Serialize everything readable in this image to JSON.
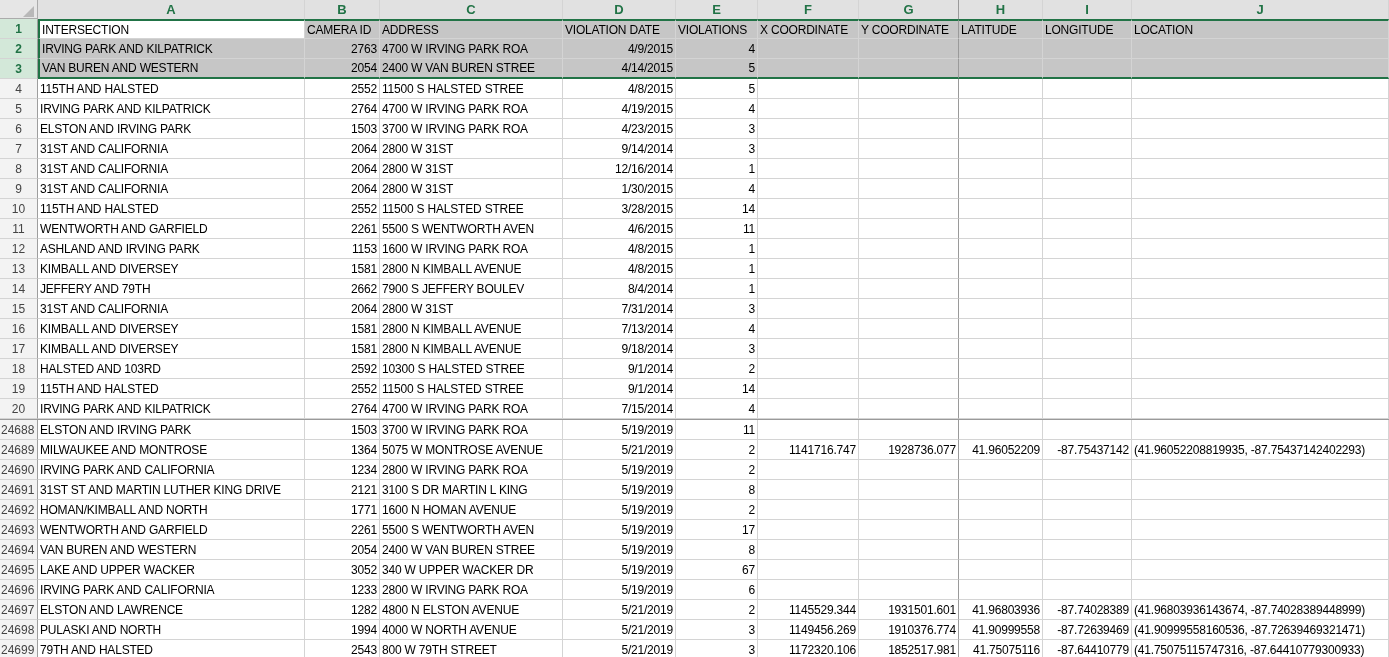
{
  "columns": [
    {
      "letter": "A",
      "kind": "text",
      "selected": true,
      "split": false
    },
    {
      "letter": "B",
      "kind": "number",
      "selected": true,
      "split": false
    },
    {
      "letter": "C",
      "kind": "text",
      "selected": true,
      "split": false
    },
    {
      "letter": "D",
      "kind": "number",
      "selected": true,
      "split": false
    },
    {
      "letter": "E",
      "kind": "number",
      "selected": true,
      "split": false
    },
    {
      "letter": "F",
      "kind": "number",
      "selected": true,
      "split": false
    },
    {
      "letter": "G",
      "kind": "number",
      "selected": true,
      "split": true
    },
    {
      "letter": "H",
      "kind": "number",
      "selected": true,
      "split": false
    },
    {
      "letter": "I",
      "kind": "number",
      "selected": true,
      "split": false
    },
    {
      "letter": "J",
      "kind": "text",
      "selected": true,
      "split": false
    }
  ],
  "frozen_rows": [
    {
      "number": "1",
      "kind": "header",
      "selected": true,
      "active": true,
      "cells": [
        "INTERSECTION",
        "CAMERA ID",
        "ADDRESS",
        "VIOLATION DATE",
        "VIOLATIONS",
        "X COORDINATE",
        "Y COORDINATE",
        "LATITUDE",
        "LONGITUDE",
        "LOCATION"
      ]
    },
    {
      "number": "2",
      "kind": "data",
      "selected": true,
      "active": false,
      "cells": [
        "IRVING PARK AND KILPATRICK",
        "2763",
        "4700 W IRVING PARK ROA",
        "4/9/2015",
        "4",
        null,
        null,
        null,
        null,
        null
      ]
    },
    {
      "number": "3",
      "kind": "data",
      "selected": true,
      "active": false,
      "cells": [
        "VAN BUREN AND WESTERN",
        "2054",
        "2400 W VAN BUREN STREE",
        "4/14/2015",
        "5",
        null,
        null,
        null,
        null,
        null
      ]
    },
    {
      "number": "4",
      "kind": "data",
      "selected": false,
      "active": false,
      "cells": [
        "115TH AND HALSTED",
        "2552",
        "11500 S HALSTED STREE",
        "4/8/2015",
        "5",
        null,
        null,
        null,
        null,
        null
      ]
    },
    {
      "number": "5",
      "kind": "data",
      "selected": false,
      "active": false,
      "cells": [
        "IRVING PARK AND KILPATRICK",
        "2764",
        "4700 W IRVING PARK ROA",
        "4/19/2015",
        "4",
        null,
        null,
        null,
        null,
        null
      ]
    },
    {
      "number": "6",
      "kind": "data",
      "selected": false,
      "active": false,
      "cells": [
        "ELSTON AND IRVING PARK",
        "1503",
        "3700 W IRVING PARK ROA",
        "4/23/2015",
        "3",
        null,
        null,
        null,
        null,
        null
      ]
    },
    {
      "number": "7",
      "kind": "data",
      "selected": false,
      "active": false,
      "cells": [
        "31ST AND CALIFORNIA",
        "2064",
        "2800 W 31ST",
        "9/14/2014",
        "3",
        null,
        null,
        null,
        null,
        null
      ]
    },
    {
      "number": "8",
      "kind": "data",
      "selected": false,
      "active": false,
      "cells": [
        "31ST AND CALIFORNIA",
        "2064",
        "2800 W 31ST",
        "12/16/2014",
        "1",
        null,
        null,
        null,
        null,
        null
      ]
    },
    {
      "number": "9",
      "kind": "data",
      "selected": false,
      "active": false,
      "cells": [
        "31ST AND CALIFORNIA",
        "2064",
        "2800 W 31ST",
        "1/30/2015",
        "4",
        null,
        null,
        null,
        null,
        null
      ]
    },
    {
      "number": "10",
      "kind": "data",
      "selected": false,
      "active": false,
      "cells": [
        "115TH AND HALSTED",
        "2552",
        "11500 S HALSTED STREE",
        "3/28/2015",
        "14",
        null,
        null,
        null,
        null,
        null
      ]
    },
    {
      "number": "11",
      "kind": "data",
      "selected": false,
      "active": false,
      "cells": [
        "WENTWORTH AND GARFIELD",
        "2261",
        "5500 S WENTWORTH AVEN",
        "4/6/2015",
        "11",
        null,
        null,
        null,
        null,
        null
      ]
    },
    {
      "number": "12",
      "kind": "data",
      "selected": false,
      "active": false,
      "cells": [
        "ASHLAND AND IRVING PARK",
        "1153",
        "1600 W IRVING PARK ROA",
        "4/8/2015",
        "1",
        null,
        null,
        null,
        null,
        null
      ]
    },
    {
      "number": "13",
      "kind": "data",
      "selected": false,
      "active": false,
      "cells": [
        "KIMBALL AND DIVERSEY",
        "1581",
        "2800 N KIMBALL AVENUE",
        "4/8/2015",
        "1",
        null,
        null,
        null,
        null,
        null
      ]
    },
    {
      "number": "14",
      "kind": "data",
      "selected": false,
      "active": false,
      "cells": [
        "JEFFERY AND 79TH",
        "2662",
        "7900 S JEFFERY BOULEV",
        "8/4/2014",
        "1",
        null,
        null,
        null,
        null,
        null
      ]
    },
    {
      "number": "15",
      "kind": "data",
      "selected": false,
      "active": false,
      "cells": [
        "31ST AND CALIFORNIA",
        "2064",
        "2800 W 31ST",
        "7/31/2014",
        "3",
        null,
        null,
        null,
        null,
        null
      ]
    },
    {
      "number": "16",
      "kind": "data",
      "selected": false,
      "active": false,
      "cells": [
        "KIMBALL AND DIVERSEY",
        "1581",
        "2800 N KIMBALL AVENUE",
        "7/13/2014",
        "4",
        null,
        null,
        null,
        null,
        null
      ]
    },
    {
      "number": "17",
      "kind": "data",
      "selected": false,
      "active": false,
      "cells": [
        "KIMBALL AND DIVERSEY",
        "1581",
        "2800 N KIMBALL AVENUE",
        "9/18/2014",
        "3",
        null,
        null,
        null,
        null,
        null
      ]
    },
    {
      "number": "18",
      "kind": "data",
      "selected": false,
      "active": false,
      "cells": [
        "HALSTED AND 103RD",
        "2592",
        "10300 S HALSTED STREE",
        "9/1/2014",
        "2",
        null,
        null,
        null,
        null,
        null
      ]
    },
    {
      "number": "19",
      "kind": "data",
      "selected": false,
      "active": false,
      "cells": [
        "115TH AND HALSTED",
        "2552",
        "11500 S HALSTED STREE",
        "9/1/2014",
        "14",
        null,
        null,
        null,
        null,
        null
      ]
    },
    {
      "number": "20",
      "kind": "data",
      "selected": false,
      "active": false,
      "cells": [
        "IRVING PARK AND KILPATRICK",
        "2764",
        "4700 W IRVING PARK ROA",
        "7/15/2014",
        "4",
        null,
        null,
        null,
        null,
        null
      ]
    }
  ],
  "scrolled_rows": [
    {
      "number": "24688",
      "kind": "data",
      "selected": false,
      "active": false,
      "cells": [
        "ELSTON AND IRVING PARK",
        "1503",
        "3700 W IRVING PARK ROA",
        "5/19/2019",
        "11",
        null,
        null,
        null,
        null,
        null
      ]
    },
    {
      "number": "24689",
      "kind": "data",
      "selected": false,
      "active": false,
      "cells": [
        "MILWAUKEE AND MONTROSE",
        "1364",
        "5075 W MONTROSE AVENUE",
        "5/21/2019",
        "2",
        "1141716.747",
        "1928736.077",
        "41.96052209",
        "-87.75437142",
        "(41.96052208819935, -87.75437142402293)"
      ]
    },
    {
      "number": "24690",
      "kind": "data",
      "selected": false,
      "active": false,
      "cells": [
        "IRVING PARK AND CALIFORNIA",
        "1234",
        "2800 W IRVING PARK ROA",
        "5/19/2019",
        "2",
        null,
        null,
        null,
        null,
        null
      ]
    },
    {
      "number": "24691",
      "kind": "data",
      "selected": false,
      "active": false,
      "cells": [
        "31ST ST AND MARTIN LUTHER KING DRIVE",
        "2121",
        "3100 S DR MARTIN L KING",
        "5/19/2019",
        "8",
        null,
        null,
        null,
        null,
        null
      ]
    },
    {
      "number": "24692",
      "kind": "data",
      "selected": false,
      "active": false,
      "cells": [
        "HOMAN/KIMBALL AND NORTH",
        "1771",
        "1600 N HOMAN AVENUE",
        "5/19/2019",
        "2",
        null,
        null,
        null,
        null,
        null
      ]
    },
    {
      "number": "24693",
      "kind": "data",
      "selected": false,
      "active": false,
      "cells": [
        "WENTWORTH AND GARFIELD",
        "2261",
        "5500 S WENTWORTH AVEN",
        "5/19/2019",
        "17",
        null,
        null,
        null,
        null,
        null
      ]
    },
    {
      "number": "24694",
      "kind": "data",
      "selected": false,
      "active": false,
      "cells": [
        "VAN BUREN AND WESTERN",
        "2054",
        "2400 W VAN BUREN STREE",
        "5/19/2019",
        "8",
        null,
        null,
        null,
        null,
        null
      ]
    },
    {
      "number": "24695",
      "kind": "data",
      "selected": false,
      "active": false,
      "cells": [
        "LAKE AND UPPER WACKER",
        "3052",
        "340 W UPPER WACKER DR",
        "5/19/2019",
        "67",
        null,
        null,
        null,
        null,
        null
      ]
    },
    {
      "number": "24696",
      "kind": "data",
      "selected": false,
      "active": false,
      "cells": [
        "IRVING PARK AND CALIFORNIA",
        "1233",
        "2800 W IRVING PARK ROA",
        "5/19/2019",
        "6",
        null,
        null,
        null,
        null,
        null
      ]
    },
    {
      "number": "24697",
      "kind": "data",
      "selected": false,
      "active": false,
      "cells": [
        "ELSTON AND LAWRENCE",
        "1282",
        "4800 N ELSTON AVENUE",
        "5/21/2019",
        "2",
        "1145529.344",
        "1931501.601",
        "41.96803936",
        "-87.74028389",
        "(41.96803936143674, -87.74028389448999)"
      ]
    },
    {
      "number": "24698",
      "kind": "data",
      "selected": false,
      "active": false,
      "cells": [
        "PULASKI AND NORTH",
        "1994",
        "4000 W NORTH AVENUE",
        "5/21/2019",
        "3",
        "1149456.269",
        "1910376.774",
        "41.90999558",
        "-87.72639469",
        "(41.90999558160536, -87.72639469321471)"
      ]
    },
    {
      "number": "24699",
      "kind": "data",
      "selected": false,
      "active": false,
      "cells": [
        "79TH AND HALSTED",
        "2543",
        "800 W 79TH STREET",
        "5/21/2019",
        "3",
        "1172320.106",
        "1852517.981",
        "41.75075116",
        "-87.64410779",
        "(41.75075115747316, -87.64410779300933)"
      ]
    }
  ]
}
